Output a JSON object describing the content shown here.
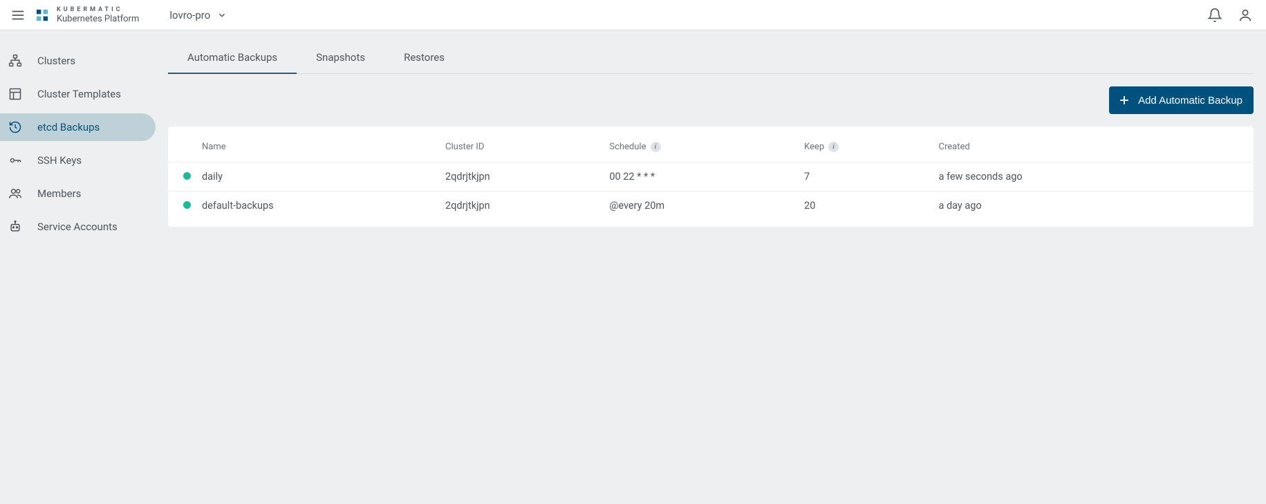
{
  "header": {
    "brand_line1": "KUBERMATIC",
    "brand_line2": "Kubernetes Platform",
    "project_name": "lovro-pro"
  },
  "sidebar": {
    "items": [
      {
        "label": "Clusters"
      },
      {
        "label": "Cluster Templates"
      },
      {
        "label": "etcd Backups"
      },
      {
        "label": "SSH Keys"
      },
      {
        "label": "Members"
      },
      {
        "label": "Service Accounts"
      }
    ]
  },
  "tabs": [
    {
      "label": "Automatic Backups"
    },
    {
      "label": "Snapshots"
    },
    {
      "label": "Restores"
    }
  ],
  "action": {
    "add_label": "Add Automatic Backup"
  },
  "table": {
    "headers": {
      "name": "Name",
      "cluster_id": "Cluster ID",
      "schedule": "Schedule",
      "keep": "Keep",
      "created": "Created"
    },
    "rows": [
      {
        "status": "green",
        "name": "daily",
        "cluster_id": "2qdrjtkjpn",
        "schedule": "00 22 * * *",
        "keep": "7",
        "created": "a few seconds ago"
      },
      {
        "status": "green",
        "name": "default-backups",
        "cluster_id": "2qdrjtkjpn",
        "schedule": "@every 20m",
        "keep": "20",
        "created": "a day ago"
      }
    ]
  }
}
